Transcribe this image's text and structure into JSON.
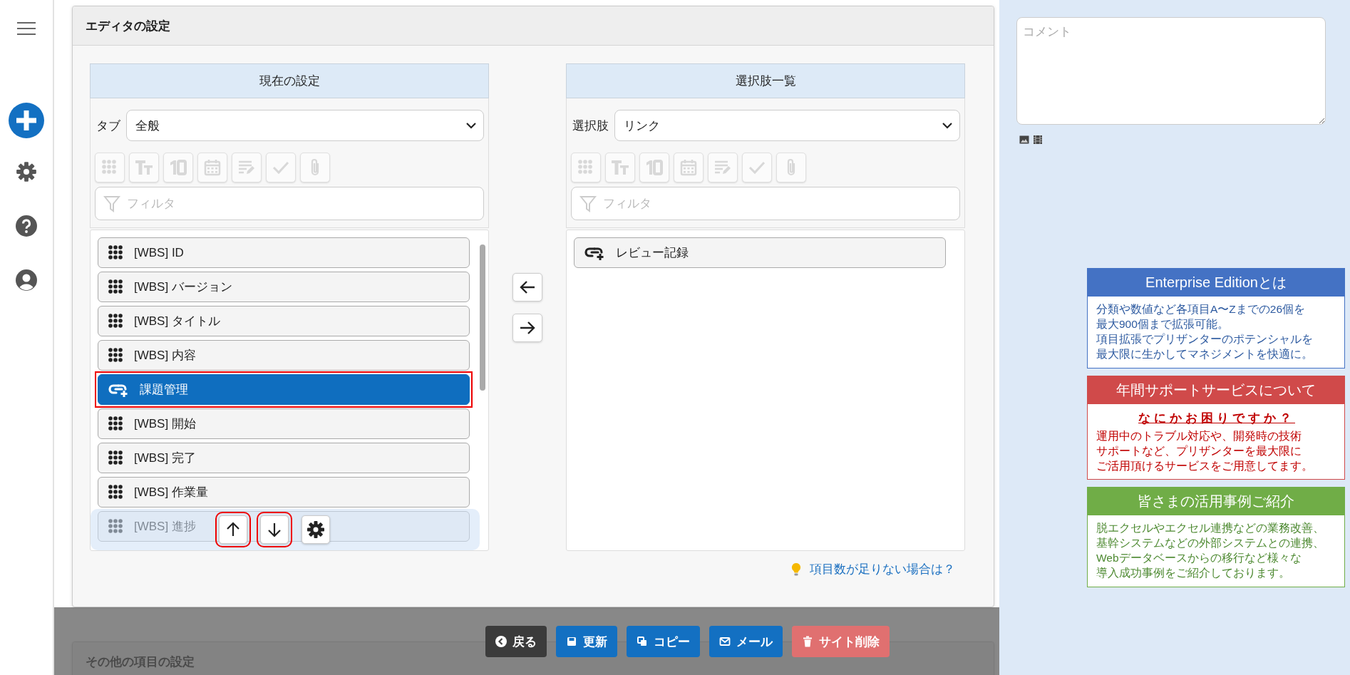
{
  "editor_settings": {
    "title": "エディタの設定",
    "current": {
      "header": "現在の設定",
      "select_label": "タブ",
      "select_value": "全般",
      "tools_disabled": true,
      "filter_placeholder": "フィルタ",
      "items": [
        {
          "label": "[WBS] ID",
          "kind": "field",
          "selected": false
        },
        {
          "label": "[WBS] バージョン",
          "kind": "field",
          "selected": false
        },
        {
          "label": "[WBS] タイトル",
          "kind": "field",
          "selected": false
        },
        {
          "label": "[WBS] 内容",
          "kind": "field",
          "selected": false
        },
        {
          "label": "課題管理",
          "kind": "link",
          "selected": true,
          "outlined": true
        },
        {
          "label": "[WBS] 開始",
          "kind": "field",
          "selected": false
        },
        {
          "label": "[WBS] 完了",
          "kind": "field",
          "selected": false
        },
        {
          "label": "[WBS] 作業量",
          "kind": "field",
          "selected": false
        },
        {
          "label": "[WBS] 進捗",
          "kind": "field",
          "selected": false
        }
      ],
      "list_actions": [
        {
          "kind": "up",
          "outlined": true
        },
        {
          "kind": "down",
          "outlined": true
        },
        {
          "kind": "settings",
          "outlined": false
        }
      ]
    },
    "choices": {
      "header": "選択肢一覧",
      "select_label": "選択肢",
      "select_value": "リンク",
      "tools_disabled": true,
      "filter_placeholder": "フィルタ",
      "items": [
        {
          "label": "レビュー記録",
          "kind": "link",
          "selected": false
        }
      ]
    },
    "hint_link": "項目数が足りない場合は？"
  },
  "other_settings": {
    "title": "その他の項目の設定"
  },
  "actions": [
    {
      "label": "戻る",
      "kind": "back"
    },
    {
      "label": "更新",
      "kind": "save"
    },
    {
      "label": "コピー",
      "kind": "copy"
    },
    {
      "label": "メール",
      "kind": "mail"
    },
    {
      "label": "サイト削除",
      "kind": "delete"
    }
  ],
  "comment": {
    "placeholder": "コメント"
  },
  "promos": [
    {
      "title": "Enterprise Editionとは",
      "kind": "enterprise",
      "color": "#4472c4",
      "lines": [
        "分類や数値など各項目A〜Zまでの26個を",
        "最大900個まで拡張可能。",
        "項目拡張でプリザンターのポテンシャルを",
        "最大限に生かしてマネジメントを快適に。"
      ]
    },
    {
      "title": "年間サポートサービスについて",
      "kind": "support",
      "color": "#d04a4a",
      "subtitle": "なにかお困りですか？",
      "lines": [
        "運用中のトラブル対応や、開発時の技術",
        "サポートなど、プリザンターを最大限に",
        "ご活用頂けるサービスをご用意してます。"
      ]
    },
    {
      "title": "皆さまの活用事例ご紹介",
      "kind": "cases",
      "color": "#70ad47",
      "lines": [
        "脱エクセルやエクセル連携などの業務改善、",
        "基幹システムなどの外部システムとの連携、",
        "Webデータベースからの移行など様々な",
        "導入成功事例をご紹介しております。"
      ]
    }
  ]
}
